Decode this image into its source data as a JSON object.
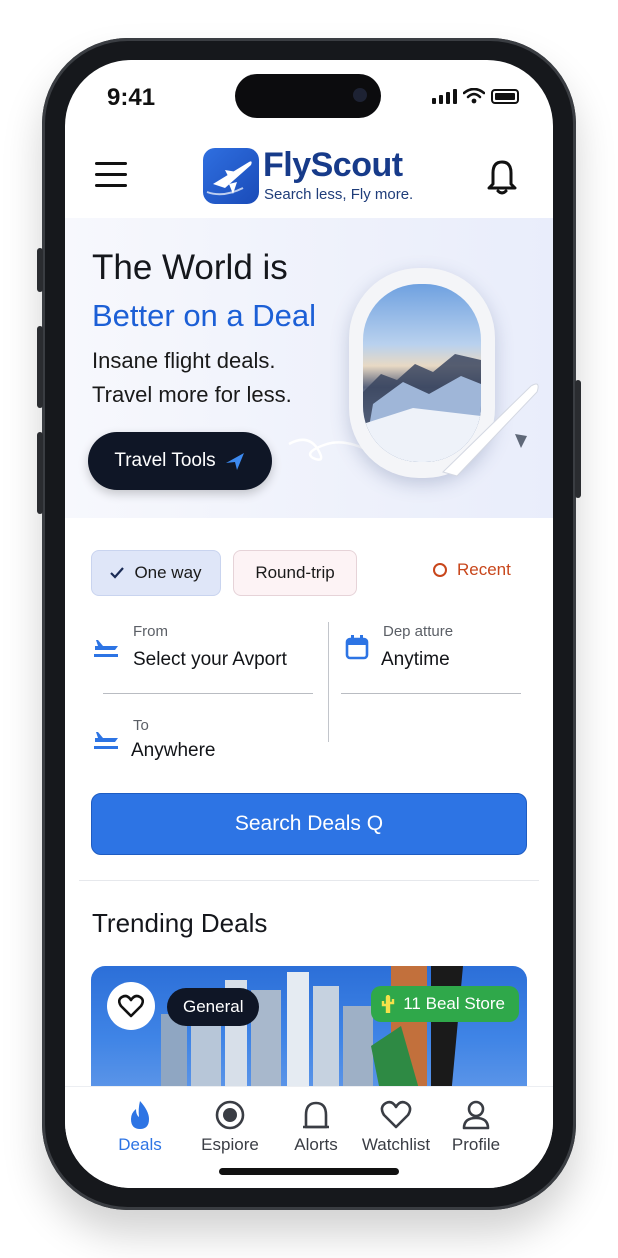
{
  "status": {
    "time": "9:41"
  },
  "header": {
    "brand": "FlyScout",
    "tagline": "Search less, Fly more."
  },
  "hero": {
    "line1": "The World is",
    "line2": "Better on a Deal",
    "line3": "Insane flight deals.",
    "line4": "Travel more for less.",
    "button": "Travel Tools"
  },
  "trip_type": {
    "one_way": "One way",
    "round_trip": "Round-trip",
    "recent": "Recent",
    "selected": "One way"
  },
  "form": {
    "from_label": "From",
    "from_value": "Select your Avport",
    "departure_label": "Dep atture",
    "departure_value": "Anytime",
    "to_label": "To",
    "to_value": "Anywhere"
  },
  "search_button": "Search Deals Q",
  "trending": {
    "title": "Trending Deals",
    "card": {
      "tag": "General",
      "store_badge": "11 Beal Store"
    }
  },
  "bottom_nav": {
    "items": [
      {
        "label": "Deals",
        "icon": "flame-icon",
        "active": true
      },
      {
        "label": "Espiore",
        "icon": "explore-icon",
        "active": false
      },
      {
        "label": "Alorts",
        "icon": "alert-icon",
        "active": false
      },
      {
        "label": "Watchlist",
        "icon": "heart-icon",
        "active": false
      },
      {
        "label": "Profile",
        "icon": "profile-icon",
        "active": false
      }
    ]
  },
  "colors": {
    "accent": "#2d74e4",
    "brand_dark": "#173b8a",
    "dark_button": "#0f1626",
    "recent": "#c8461b",
    "badge_green": "#2fa84a"
  }
}
